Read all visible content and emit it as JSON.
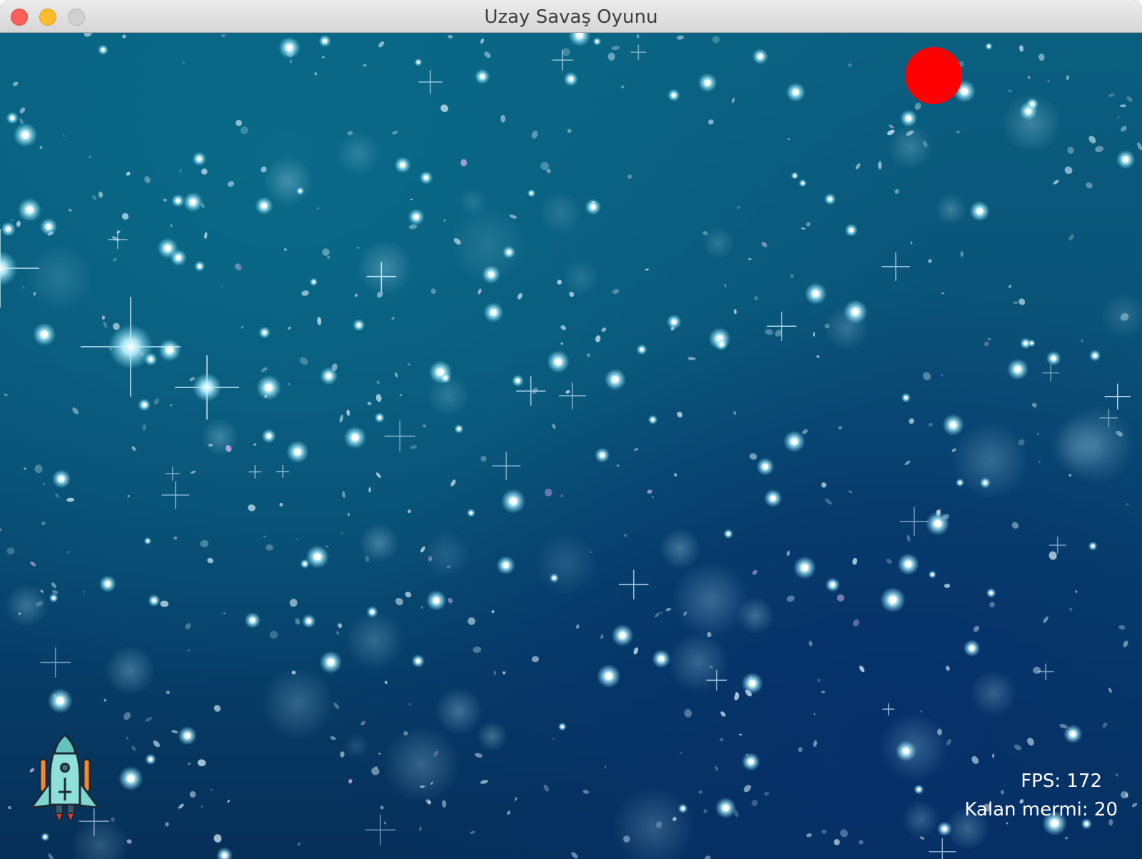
{
  "window": {
    "title": "Uzay Savaş Oyunu"
  },
  "colors": {
    "enemy": "#ff0000",
    "hud_text": "#ffffff"
  },
  "icons": {
    "player": "rocket-ship-icon",
    "enemy": "red-circle-enemy"
  },
  "hud": {
    "fps_label": "FPS:",
    "fps_value": "172",
    "ammo_label": "Kalan mermi:",
    "ammo_value": "20"
  }
}
